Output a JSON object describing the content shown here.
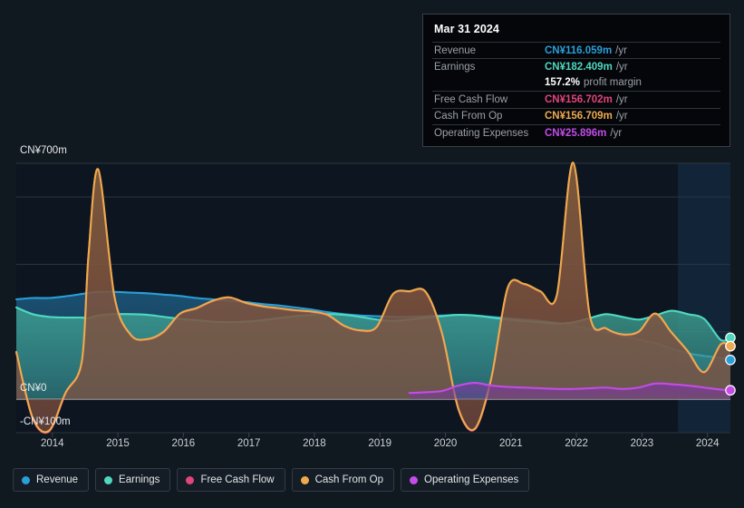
{
  "tooltip": {
    "date": "Mar 31 2024",
    "rows": [
      {
        "label": "Revenue",
        "value": "CN¥116.059m",
        "unit": "/yr",
        "color": "#2a9ed8"
      },
      {
        "label": "Earnings",
        "value": "CN¥182.409m",
        "unit": "/yr",
        "color": "#4fd8c0"
      },
      {
        "label": "",
        "value": "157.2%",
        "unit": "profit margin",
        "color": "#ffffff"
      },
      {
        "label": "Free Cash Flow",
        "value": "CN¥156.702m",
        "unit": "/yr",
        "color": "#e0457b"
      },
      {
        "label": "Cash From Op",
        "value": "CN¥156.709m",
        "unit": "/yr",
        "color": "#eeaa4d"
      },
      {
        "label": "Operating Expenses",
        "value": "CN¥25.896m",
        "unit": "/yr",
        "color": "#c44ce8"
      }
    ]
  },
  "legend": [
    {
      "label": "Revenue",
      "color": "#2a9ed8"
    },
    {
      "label": "Earnings",
      "color": "#4fd8c0"
    },
    {
      "label": "Free Cash Flow",
      "color": "#e0457b"
    },
    {
      "label": "Cash From Op",
      "color": "#eeaa4d"
    },
    {
      "label": "Operating Expenses",
      "color": "#c44ce8"
    }
  ],
  "chart_data": {
    "type": "area",
    "title": "",
    "xlabel": "",
    "ylabel": "",
    "currency": "CN¥",
    "unit": "m",
    "ylim": [
      -100,
      700
    ],
    "y_ticks": [
      700,
      600,
      500,
      400,
      300,
      200,
      100,
      0,
      -100
    ],
    "y_tick_labels_shown": [
      "CN¥700m",
      "CN¥0",
      "-CN¥100m"
    ],
    "gridlines": [
      700,
      600,
      400,
      200,
      0,
      -100
    ],
    "grid": true,
    "legend_position": "bottom",
    "x_tick_labels": [
      "2014",
      "2015",
      "2016",
      "2017",
      "2018",
      "2019",
      "2020",
      "2021",
      "2022",
      "2023",
      "2024"
    ],
    "xlim": [
      2013.45,
      2024.35
    ],
    "x": [
      2013.45,
      2013.7,
      2013.95,
      2014.2,
      2014.45,
      2014.55,
      2014.7,
      2014.95,
      2015.2,
      2015.45,
      2015.7,
      2015.95,
      2016.2,
      2016.45,
      2016.7,
      2016.95,
      2017.2,
      2017.45,
      2017.7,
      2017.95,
      2018.2,
      2018.45,
      2018.7,
      2018.95,
      2019.2,
      2019.45,
      2019.7,
      2019.95,
      2020.2,
      2020.45,
      2020.7,
      2020.95,
      2021.2,
      2021.45,
      2021.7,
      2021.95,
      2022.2,
      2022.45,
      2022.7,
      2022.95,
      2023.2,
      2023.45,
      2023.7,
      2023.95,
      2024.2,
      2024.35
    ],
    "series": [
      {
        "name": "Revenue",
        "color": "#2a9ed8",
        "fill": "#1d5a80",
        "values": [
          296,
          300,
          300,
          305,
          312,
          315,
          318,
          318,
          316,
          314,
          310,
          306,
          300,
          296,
          292,
          288,
          282,
          278,
          272,
          266,
          258,
          252,
          248,
          246,
          244,
          244,
          246,
          248,
          250,
          248,
          244,
          240,
          236,
          232,
          226,
          218,
          208,
          198,
          188,
          176,
          166,
          150,
          136,
          128,
          122,
          116
        ]
      },
      {
        "name": "Earnings",
        "color": "#4fd8c0",
        "fill": "#3d9d90",
        "values": [
          272,
          252,
          244,
          242,
          242,
          240,
          248,
          252,
          252,
          250,
          244,
          238,
          234,
          230,
          228,
          230,
          234,
          240,
          246,
          250,
          252,
          250,
          244,
          236,
          232,
          236,
          242,
          246,
          250,
          248,
          242,
          236,
          232,
          228,
          224,
          228,
          240,
          252,
          244,
          236,
          248,
          262,
          252,
          238,
          176,
          182
        ]
      },
      {
        "name": "Free Cash Flow",
        "color": "#e0457b",
        "fill": "#8a3450",
        "values": [
          138,
          -58,
          -96,
          16,
          110,
          420,
          680,
          300,
          188,
          176,
          198,
          252,
          268,
          290,
          300,
          284,
          274,
          268,
          262,
          258,
          248,
          216,
          202,
          212,
          310,
          318,
          316,
          192,
          -32,
          -90,
          60,
          328,
          340,
          318,
          306,
          700,
          250,
          208,
          190,
          198,
          252,
          196,
          140,
          78,
          160,
          157
        ]
      },
      {
        "name": "Cash From Op",
        "color": "#eeaa4d",
        "fill": "#7a5e38",
        "values": [
          140,
          -56,
          -94,
          18,
          112,
          422,
          682,
          302,
          190,
          178,
          200,
          254,
          270,
          292,
          302,
          286,
          276,
          270,
          264,
          260,
          250,
          218,
          204,
          214,
          312,
          320,
          318,
          194,
          -30,
          -88,
          62,
          330,
          342,
          320,
          308,
          702,
          252,
          210,
          192,
          200,
          254,
          198,
          142,
          80,
          162,
          157
        ]
      },
      {
        "name": "Operating Expenses",
        "color": "#c44ce8",
        "fill": "#7a3a9c",
        "values": [
          null,
          null,
          null,
          null,
          null,
          null,
          null,
          null,
          null,
          null,
          null,
          null,
          null,
          null,
          null,
          null,
          null,
          null,
          null,
          null,
          null,
          null,
          null,
          null,
          null,
          18,
          20,
          24,
          40,
          48,
          40,
          36,
          34,
          32,
          30,
          30,
          32,
          34,
          30,
          34,
          46,
          44,
          40,
          34,
          28,
          26
        ]
      }
    ],
    "highlight_band": {
      "from": 2023.55,
      "to": 2024.35
    },
    "fill_change_at": 2018.3
  }
}
